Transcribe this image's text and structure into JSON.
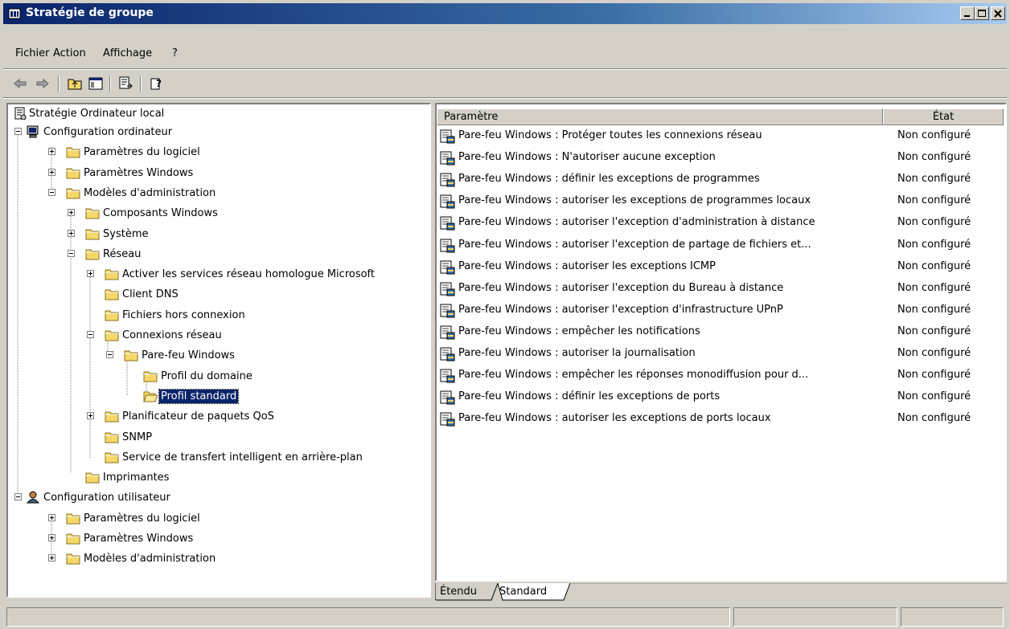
{
  "window": {
    "title": "Stratégie de groupe",
    "icon": "group-policy-icon"
  },
  "menu": {
    "items": [
      "Fichier",
      "Action",
      "Affichage",
      "?"
    ]
  },
  "toolbar": {
    "buttons": [
      "back-arrow-icon",
      "forward-arrow-icon",
      "up-folder-icon",
      "show-hide-tree-icon",
      "export-list-icon",
      "help-icon"
    ]
  },
  "tree": {
    "root": "Stratégie Ordinateur local",
    "nodes": [
      "Configuration ordinateur",
      "Paramètres du logiciel",
      "Paramètres Windows",
      "Modèles d'administration",
      "Composants Windows",
      "Système",
      "Réseau",
      "Activer les services réseau homologue Microsoft",
      "Client DNS",
      "Fichiers hors connexion",
      "Connexions réseau",
      "Pare-feu Windows",
      "Profil du domaine",
      "Profil standard",
      "Planificateur de paquets QoS",
      "SNMP",
      "Service de transfert intelligent en arrière-plan",
      "Imprimantes",
      "Configuration utilisateur",
      "Paramètres du logiciel",
      "Paramètres Windows",
      "Modèles d'administration"
    ],
    "selected": "Profil standard"
  },
  "list": {
    "headers": {
      "parameter": "Paramètre",
      "state": "État"
    },
    "rows": [
      {
        "parameter": "Pare-feu Windows : Protéger toutes les connexions réseau",
        "state": "Non configuré"
      },
      {
        "parameter": "Pare-feu Windows : N'autoriser aucune exception",
        "state": "Non configuré"
      },
      {
        "parameter": "Pare-feu Windows : définir les exceptions de programmes",
        "state": "Non configuré"
      },
      {
        "parameter": "Pare-feu Windows : autoriser les exceptions de programmes locaux",
        "state": "Non configuré"
      },
      {
        "parameter": "Pare-feu Windows : autoriser l'exception d'administration à distance",
        "state": "Non configuré"
      },
      {
        "parameter": "Pare-feu Windows : autoriser l'exception de partage de fichiers et...",
        "state": "Non configuré"
      },
      {
        "parameter": "Pare-feu Windows : autoriser les exceptions ICMP",
        "state": "Non configuré"
      },
      {
        "parameter": "Pare-feu Windows : autoriser l'exception du Bureau à distance",
        "state": "Non configuré"
      },
      {
        "parameter": "Pare-feu Windows : autoriser l'exception d'infrastructure UPnP",
        "state": "Non configuré"
      },
      {
        "parameter": "Pare-feu Windows : empêcher les notifications",
        "state": "Non configuré"
      },
      {
        "parameter": "Pare-feu Windows : autoriser la journalisation",
        "state": "Non configuré"
      },
      {
        "parameter": "Pare-feu Windows : empêcher les réponses monodiffusion pour d...",
        "state": "Non configuré"
      },
      {
        "parameter": "Pare-feu Windows : définir les exceptions de ports",
        "state": "Non configuré"
      },
      {
        "parameter": "Pare-feu Windows : autoriser les exceptions de ports locaux",
        "state": "Non configuré"
      }
    ]
  },
  "tabs": {
    "items": [
      "Étendu",
      "Standard"
    ],
    "active": "Standard"
  },
  "colors": {
    "titlebar_start": "#0a246a",
    "titlebar_end": "#a6caf0",
    "face": "#d4d0c8",
    "selection": "#0a246a",
    "folder": "#f5d86a"
  }
}
